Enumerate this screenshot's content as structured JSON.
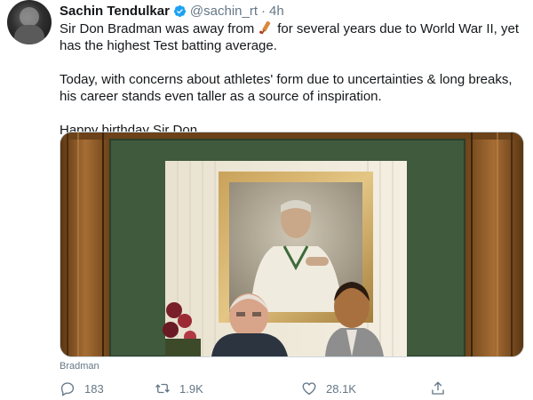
{
  "tweet": {
    "author": {
      "display_name": "Sachin Tendulkar",
      "handle": "@sachin_rt",
      "separator": "·",
      "time": "4h",
      "verified": true
    },
    "text": {
      "line1_before": "Sir Don Bradman was away from",
      "line1_emoji": "cricket-bat-icon",
      "line1_after": "for several years due to World War II, yet has the highest Test batting average.",
      "paragraph2": "Today, with concerns about athletes' form due to uncertainties & long breaks, his career stands even taller as a source of inspiration.",
      "paragraph3": "Happy birthday Sir Don."
    },
    "media": {
      "caption": "Bradman"
    },
    "actions": {
      "reply_count": "183",
      "retweet_count": "1.9K",
      "like_count": "28.1K"
    }
  },
  "colors": {
    "text_primary": "#14171a",
    "text_secondary": "#657786",
    "verified_blue": "#1da1f2",
    "frame_wood": "#8a5a2b",
    "mat_green": "#3f5a3c"
  }
}
